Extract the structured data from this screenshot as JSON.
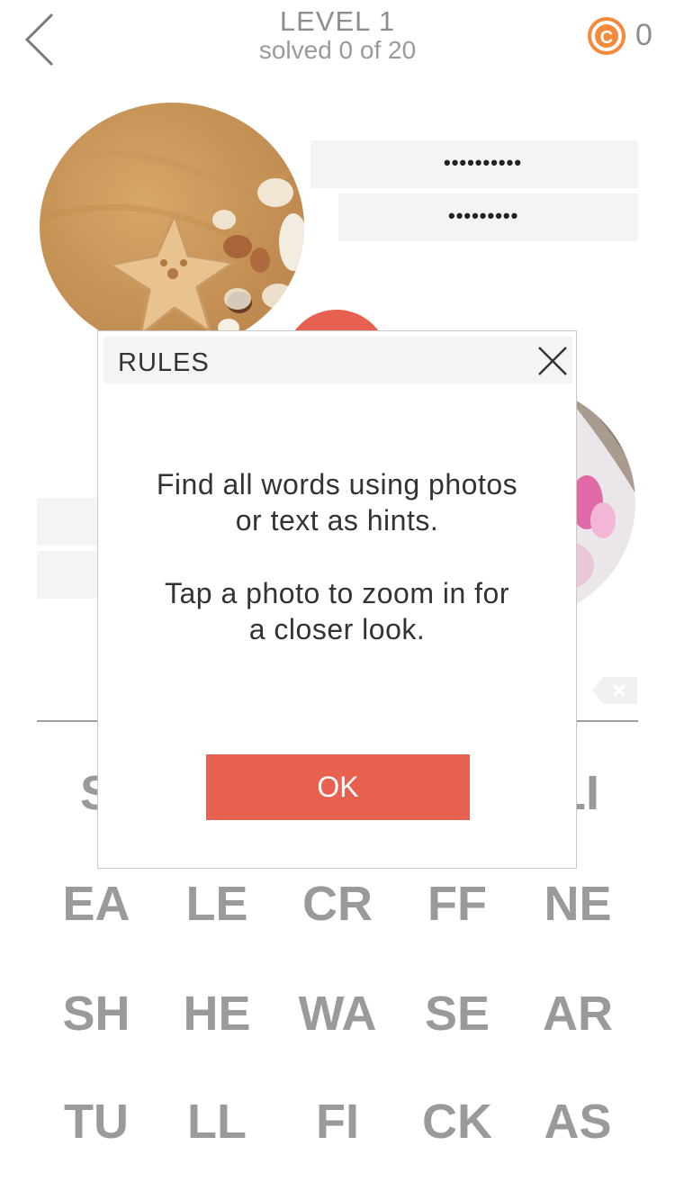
{
  "header": {
    "title": "LEVEL 1",
    "subtitle": "solved 0 of 20",
    "coins": "0"
  },
  "answers": [
    {
      "mask": "••••••••••"
    },
    {
      "mask": "•••••••••"
    }
  ],
  "letters": {
    "row1": [
      "S",
      "",
      "",
      "",
      "LI"
    ],
    "row2": [
      "EA",
      "LE",
      "CR",
      "FF",
      "NE"
    ],
    "row3": [
      "SH",
      "HE",
      "WA",
      "SE",
      "AR"
    ],
    "row4": [
      "TU",
      "LL",
      "FI",
      "CK",
      "AS"
    ]
  },
  "modal": {
    "title": "RULES",
    "line1": "Find all words using photos",
    "line2": "or text as hints.",
    "line3": "Tap a photo to zoom in for",
    "line4": "a closer look.",
    "ok_label": "OK"
  },
  "colors": {
    "accent": "#e8604f",
    "coin": "#f58a3a",
    "tile_text": "#9a9a9a"
  }
}
